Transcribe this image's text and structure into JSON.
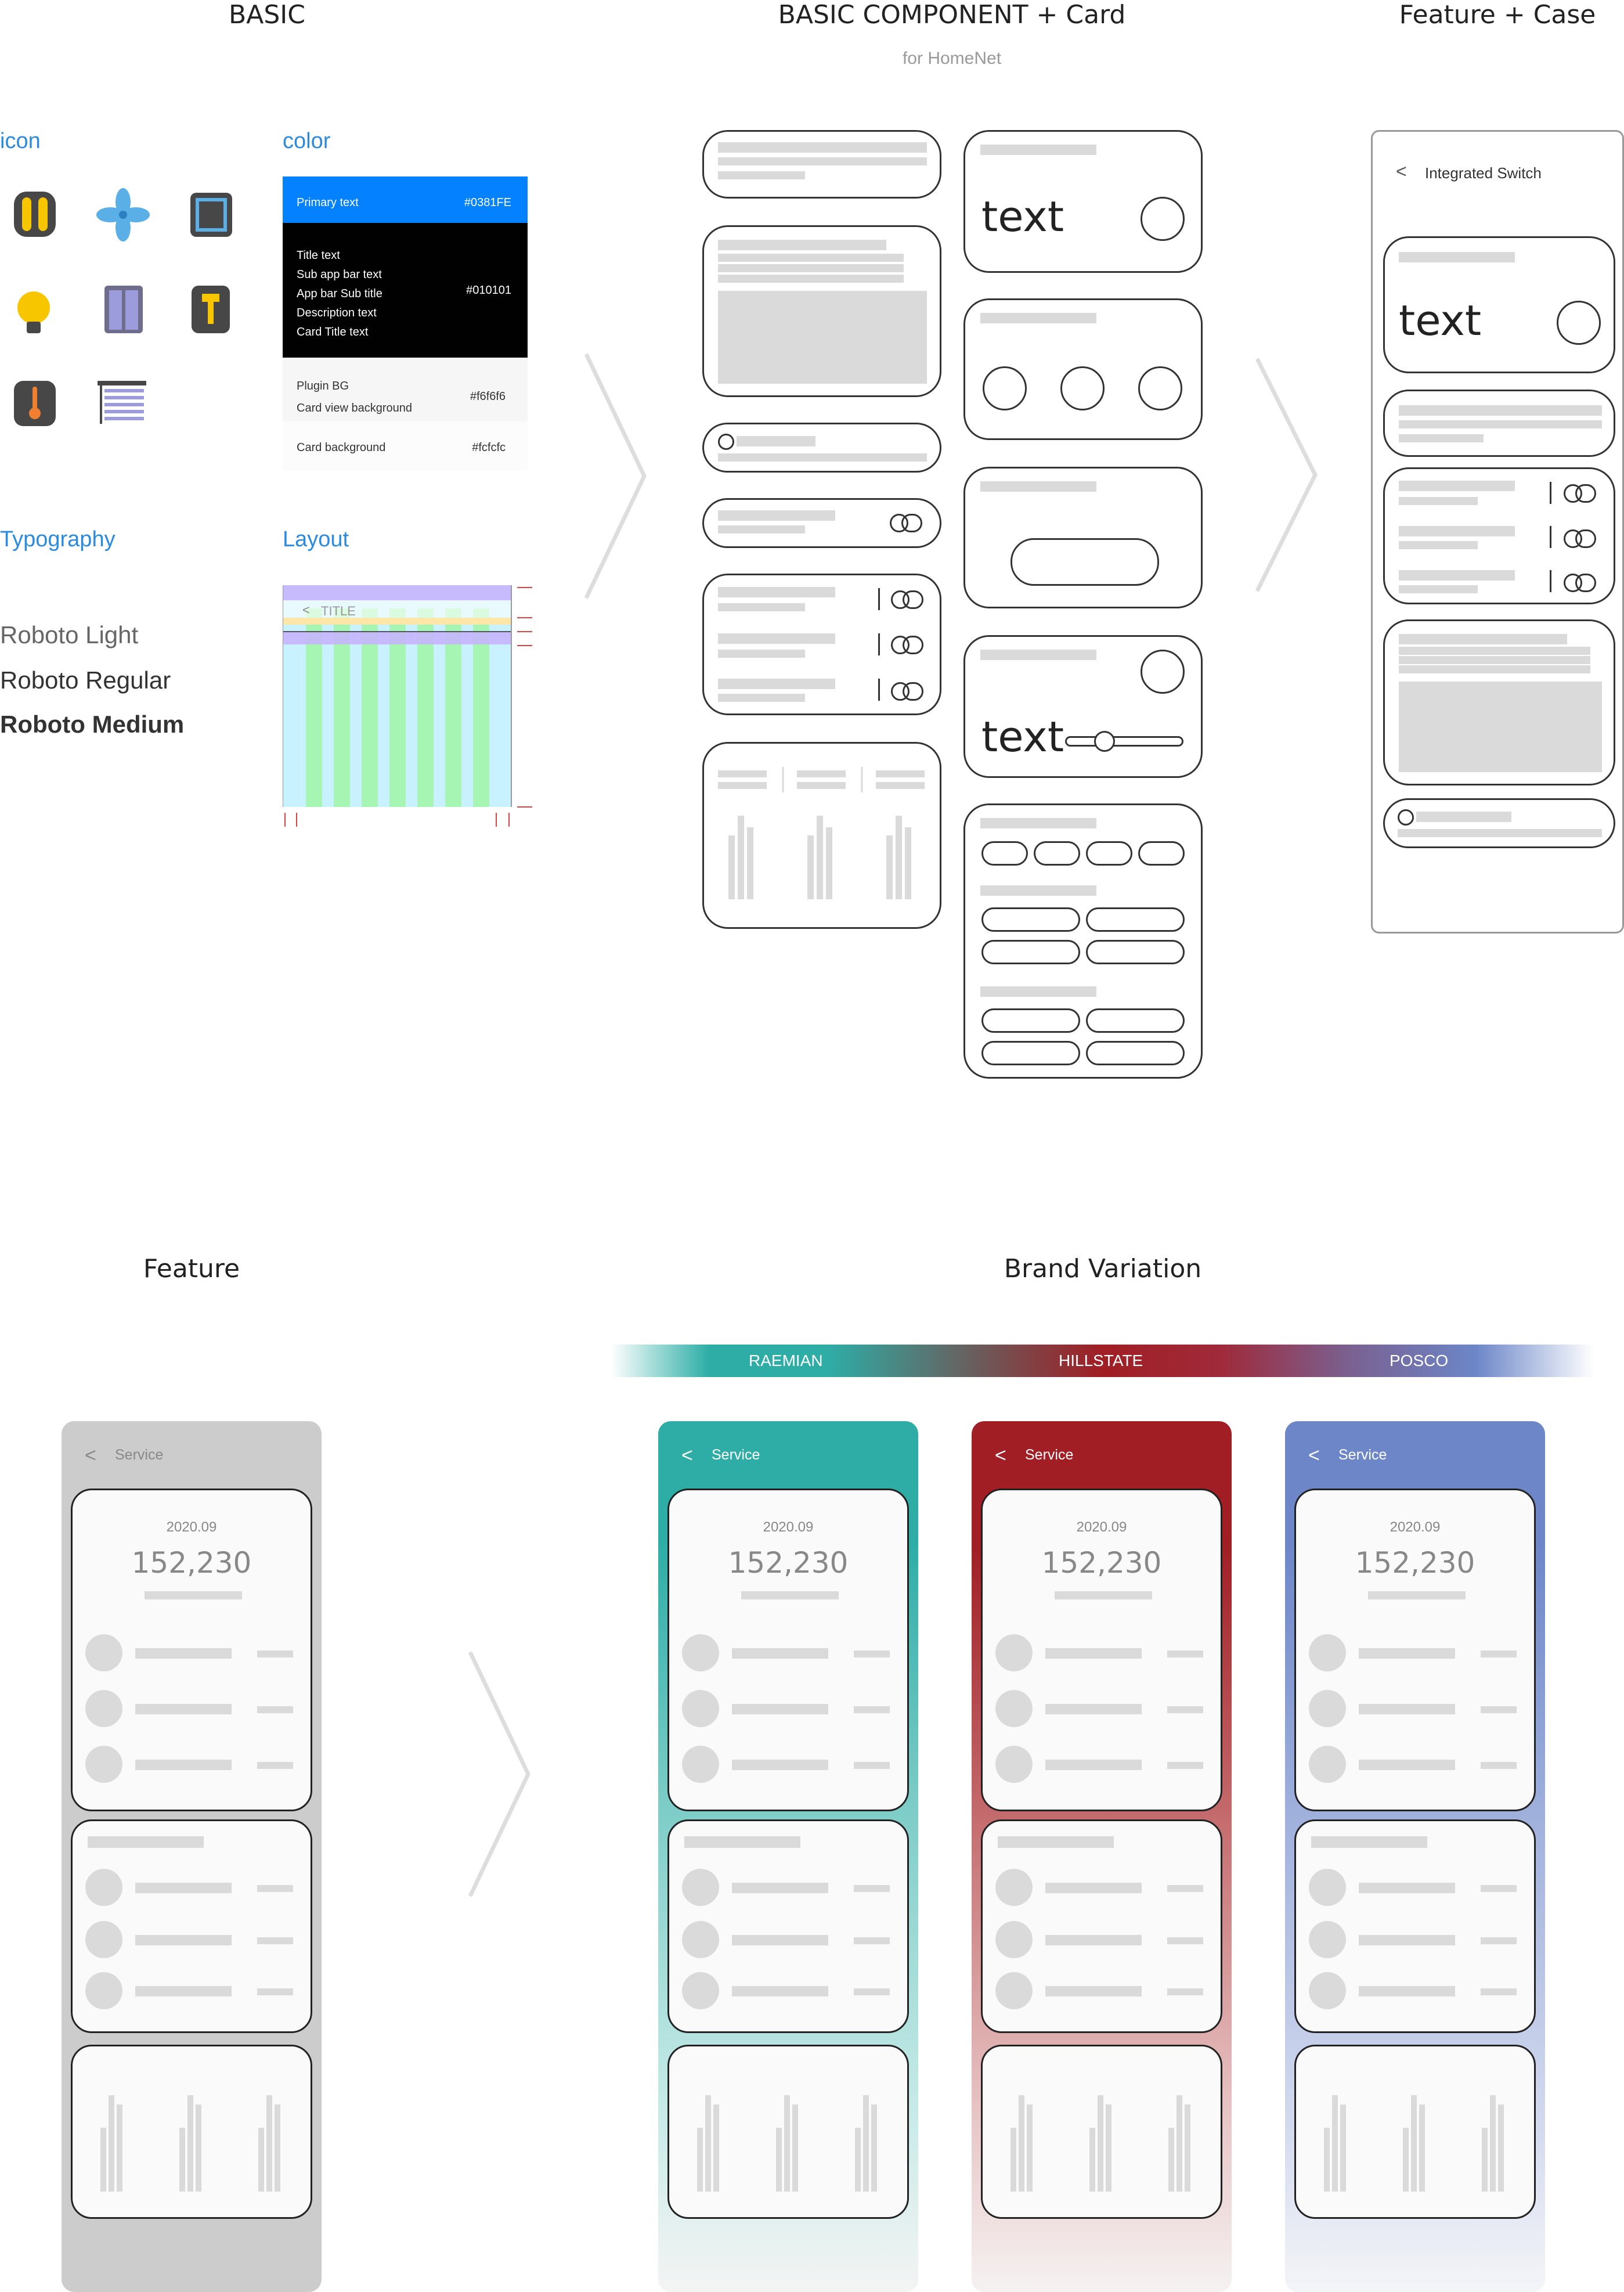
{
  "sections": {
    "basic": "BASIC",
    "basic_component": "BASIC COMPONENT + Card",
    "basic_component_sub": "for HomeNet",
    "feature_case": "Feature + Case",
    "feature": "Feature",
    "brand_variation": "Brand Variation"
  },
  "basic": {
    "icon_label": "icon",
    "color_label": "color",
    "typography_label": "Typography",
    "layout_label": "Layout",
    "icons": [
      "power-switch-icon",
      "fan-icon",
      "frame-icon",
      "bulb-icon",
      "elevator-icon",
      "lamp-switch-icon",
      "thermometer-icon",
      "blind-icon"
    ],
    "colors": {
      "primary": {
        "text": "Primary text",
        "hex": "#0381FE",
        "bg": "#0381FE"
      },
      "dark": {
        "lines": [
          "Title text",
          "Sub app bar text",
          "App bar Sub title",
          "Description text",
          "Card Title text"
        ],
        "hex": "#010101",
        "bg": "#010101"
      },
      "plugin": {
        "lines": [
          "Plugin BG",
          "Card view background"
        ],
        "hex": "#f6f6f6",
        "bg": "#f6f6f6"
      },
      "card": {
        "text": "Card background",
        "hex": "#fcfcfc",
        "bg": "#fcfcfc"
      }
    },
    "typography": [
      "Roboto Light",
      "Roboto Regular",
      "Roboto Medium"
    ],
    "layout_title": "TITLE",
    "layout_back": "<"
  },
  "components": {
    "text_label_1": "text",
    "text_label_2": "text",
    "text_label_3": "text"
  },
  "feature_case": {
    "title": "Integrated Switch",
    "back": "<",
    "text_label": "text"
  },
  "feature_phone": {
    "back": "<",
    "title": "Service",
    "date": "2020.09",
    "value": "152,230"
  },
  "brands": [
    {
      "name": "RAEMIAN",
      "color": "#2eada6",
      "back": "<",
      "title": "Service",
      "date": "2020.09",
      "value": "152,230"
    },
    {
      "name": "HILLSTATE",
      "color": "#a01e24",
      "back": "<",
      "title": "Service",
      "date": "2020.09",
      "value": "152,230"
    },
    {
      "name": "POSCO",
      "color": "#6c86c8",
      "back": "<",
      "title": "Service",
      "date": "2020.09",
      "value": "152,230"
    }
  ]
}
